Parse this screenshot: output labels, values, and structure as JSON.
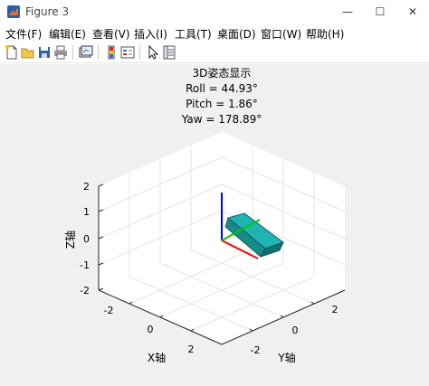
{
  "window": {
    "title": "Figure 3",
    "minimize_glyph": "—",
    "maximize_glyph": "☐",
    "close_glyph": "✕"
  },
  "menu": {
    "items": [
      {
        "label": "文件(F)"
      },
      {
        "label": "编辑(E)"
      },
      {
        "label": "查看(V)"
      },
      {
        "label": "插入(I)"
      },
      {
        "label": "工具(T)"
      },
      {
        "label": "桌面(D)"
      },
      {
        "label": "窗口(W)"
      },
      {
        "label": "帮助(H)"
      }
    ]
  },
  "toolbar": {
    "icons": [
      "new-figure-icon",
      "open-file-icon",
      "save-icon",
      "print-icon",
      "link-plot-icon",
      "colorbar-icon",
      "legend-icon",
      "pointer-icon",
      "property-inspector-icon"
    ]
  },
  "plot": {
    "title_lines": [
      "3D姿态显示",
      "Roll = 44.93°",
      "Pitch = 1.86°",
      "Yaw = 178.89°"
    ],
    "xlabel": "X轴",
    "ylabel": "Y轴",
    "zlabel": "Z轴",
    "x_ticks": [
      "-2",
      "0",
      "2"
    ],
    "y_ticks": [
      "-2",
      "0",
      "2"
    ],
    "z_ticks": [
      "2",
      "1",
      "0",
      "-1",
      "-2"
    ],
    "colors": {
      "background": "#f0f0f0",
      "axes_face": "#ffffff",
      "grid": "#e6e6e6",
      "box_body": "#1aa5a5",
      "axis_x": "#ff0000",
      "axis_y": "#00cc00",
      "axis_z": "#0000ff"
    }
  }
}
